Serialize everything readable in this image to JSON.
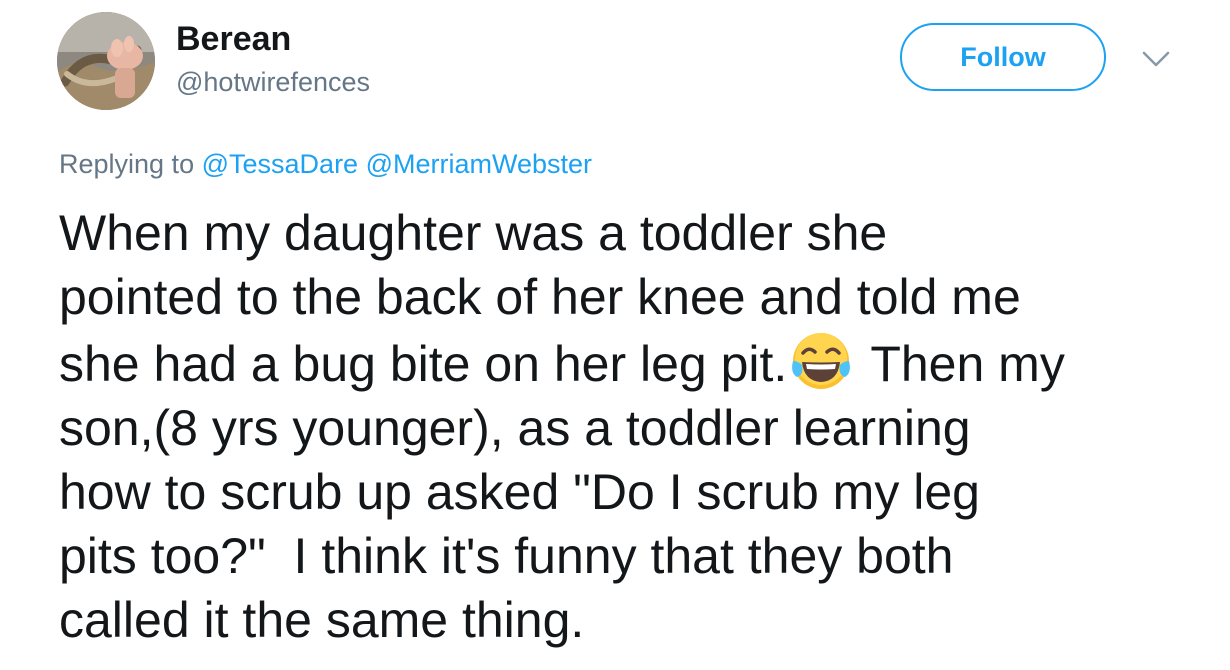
{
  "user": {
    "display_name": "Berean",
    "handle": "@hotwirefences"
  },
  "actions": {
    "follow_label": "Follow",
    "menu_icon": "chevron-down-icon"
  },
  "reply": {
    "prefix": "Replying to",
    "mentions": [
      "@TessaDare",
      "@MerriamWebster"
    ]
  },
  "tweet": {
    "lines": [
      "When my daughter was a toddler she",
      "pointed to the back of her knee and told me",
      "she had a bug bite on her leg pit.",
      " Then my",
      "son,(8 yrs younger), as a toddler learning",
      "how to scrub up asked \"Do I scrub my leg",
      "pits too?\"  I think it's funny that they both",
      "called it the same thing."
    ],
    "emoji": "face-with-tears-of-joy-icon"
  },
  "colors": {
    "accent": "#1da1f2",
    "text": "#14171a",
    "secondary": "#657786"
  }
}
